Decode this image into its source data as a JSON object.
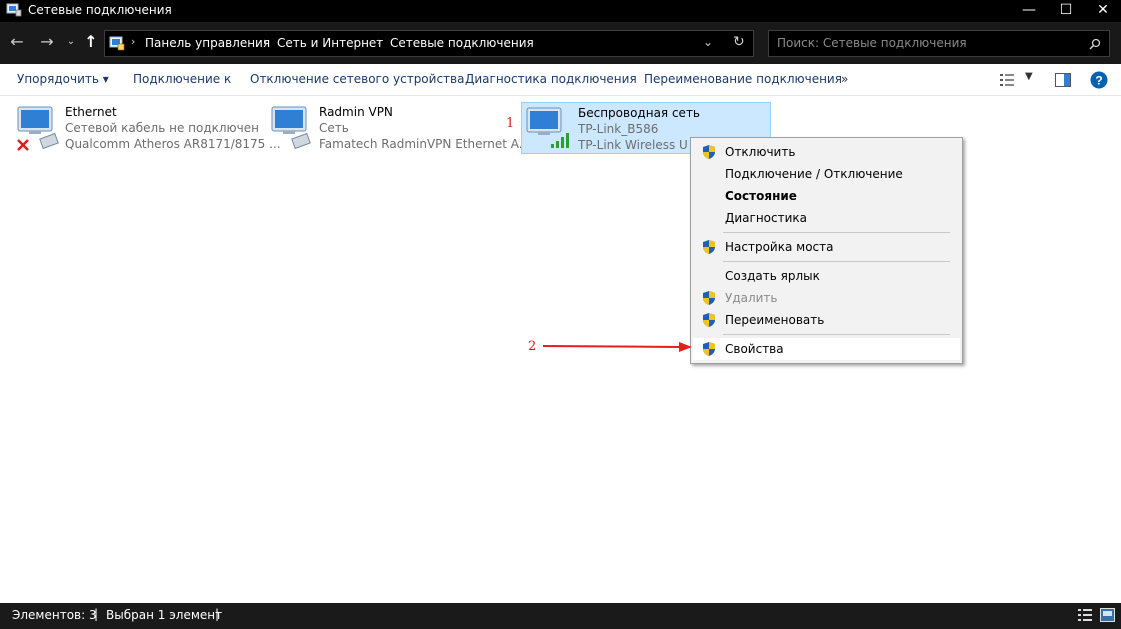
{
  "window": {
    "title": "Сетевые подключения",
    "minimize": "—",
    "maximize": "☐",
    "close": "✕"
  },
  "address": {
    "breadcrumbs": [
      "Панель управления",
      "Сеть и Интернет",
      "Сетевые подключения"
    ],
    "separator": "›",
    "search_placeholder": "Поиск: Сетевые подключения"
  },
  "commands": {
    "organize": "Упорядочить ▾",
    "connect_to": "Подключение к",
    "disable_device": "Отключение сетевого устройства",
    "diagnose": "Диагностика подключения",
    "rename": "Переименование подключения",
    "more": "»"
  },
  "connections": [
    {
      "name": "Ethernet",
      "status": "Сетевой кабель не подключен",
      "adapter": "Qualcomm Atheros AR8171/8175 ..."
    },
    {
      "name": "Radmin VPN",
      "status": "Сеть",
      "adapter": "Famatech RadminVPN Ethernet A..."
    },
    {
      "name": "Беспроводная сеть",
      "status": "TP-Link_B586",
      "adapter": "TP-Link Wireless USB"
    }
  ],
  "context_menu": {
    "items": [
      {
        "label": "Отключить"
      },
      {
        "label": "Подключение / Отключение"
      },
      {
        "label": "Состояние"
      },
      {
        "label": "Диагностика"
      },
      {
        "label": "Настройка моста"
      },
      {
        "label": "Создать ярлык"
      },
      {
        "label": "Удалить"
      },
      {
        "label": "Переименовать"
      },
      {
        "label": "Свойства"
      }
    ]
  },
  "annotations": {
    "one": "1",
    "two": "2"
  },
  "status": {
    "items_count": "Элементов: 3",
    "selected": "Выбран 1 элемент"
  },
  "colors": {
    "accent": "#0078d7",
    "selection": "#cce8ff",
    "annotation": "#e0201b",
    "titlebar": "#000000"
  }
}
